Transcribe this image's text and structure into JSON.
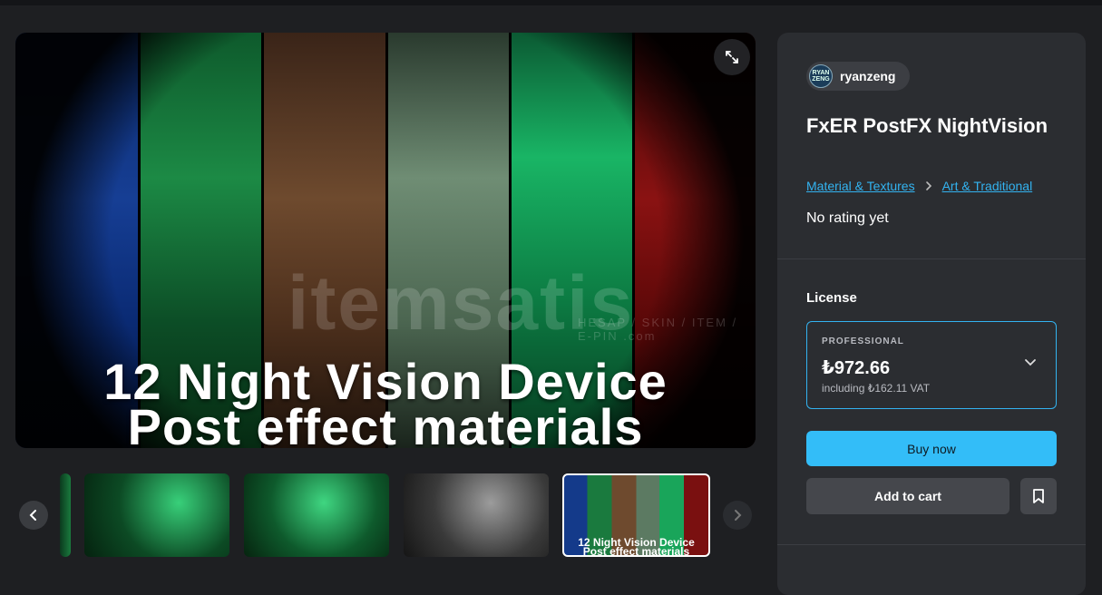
{
  "hero": {
    "line1": "12 Night Vision Device",
    "line2": "Post effect materials",
    "watermark": "itemsatis",
    "watermark_sub": "HESAP / SKIN / ITEM / E-PIN .com"
  },
  "thumbnails": {
    "selected_line1": "12 Night Vision Device",
    "selected_line2": "Post effect materials"
  },
  "product": {
    "seller_avatar_text": "RYAN ZENG",
    "seller_name": "ryanzeng",
    "title": "FxER PostFX NightVision",
    "breadcrumb": [
      "Material & Textures",
      "Art & Traditional"
    ],
    "rating_text": "No rating yet"
  },
  "license": {
    "heading": "License",
    "tier": "PROFESSIONAL",
    "price": "₺972.66",
    "vat": "including ₺162.11 VAT"
  },
  "actions": {
    "buy_now": "Buy now",
    "add_to_cart": "Add to cart"
  },
  "colors": {
    "accent": "#33b3f0",
    "button_primary": "#33bdf8",
    "panel_bg": "#2b2d31",
    "page_bg": "#1e1f22"
  },
  "icons": [
    "expand-icon",
    "chevron-left-icon",
    "chevron-right-icon",
    "chevron-down-icon",
    "bookmark-icon",
    "breadcrumb-chevron-icon"
  ]
}
